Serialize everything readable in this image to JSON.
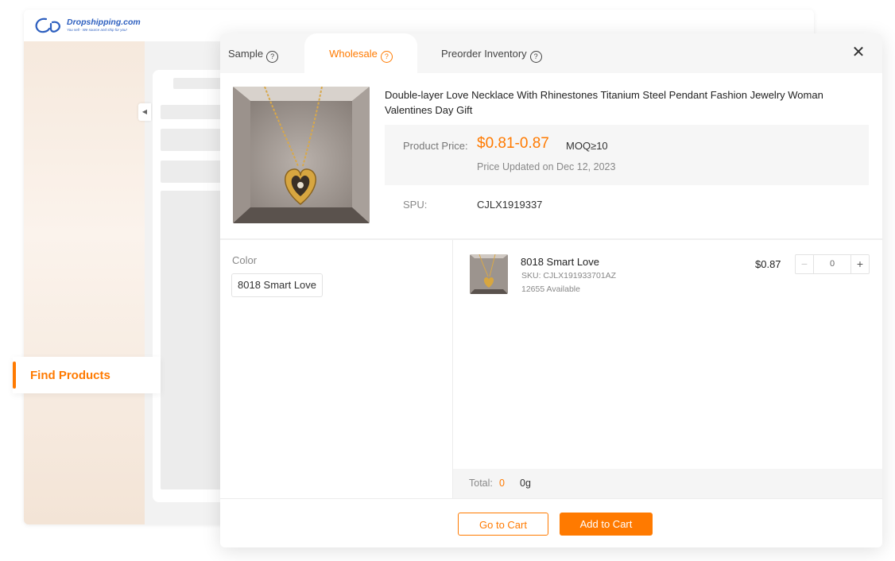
{
  "logo": {
    "text": "Dropshipping.com",
    "tagline": "You sell - We source and ship for you!"
  },
  "sidebar": {
    "find_products": "Find Products"
  },
  "modal": {
    "tabs": [
      {
        "label": "Sample",
        "help": "?"
      },
      {
        "label": "Wholesale",
        "help": "?"
      },
      {
        "label": "Preorder Inventory",
        "help": "?"
      }
    ],
    "active_tab": "Wholesale",
    "close": "✕",
    "product": {
      "title": "Double-layer Love Necklace With Rhinestones Titanium Steel Pendant Fashion Jewelry Woman Valentines Day Gift",
      "price_label": "Product Price:",
      "price": "$0.81-0.87",
      "moq": "MOQ≥10",
      "price_updated": "Price Updated on Dec 12, 2023",
      "spu_label": "SPU:",
      "spu": "CJLX1919337"
    },
    "color": {
      "label": "Color",
      "selected": "8018 Smart Love"
    },
    "variant": {
      "name": "8018 Smart Love",
      "sku": "SKU: CJLX191933701AZ",
      "stock": "12655 Available",
      "price": "$0.87",
      "quantity": "0",
      "minus": "−",
      "plus": "+"
    },
    "total": {
      "label": "Total:",
      "count": "0",
      "weight": "0g"
    },
    "buttons": {
      "go_to_cart": "Go to Cart",
      "add_to_cart": "Add to Cart"
    }
  },
  "colors": {
    "accent": "#ff7a00",
    "brand_blue": "#2d5fbf"
  },
  "icons": {
    "help": "question-circle-icon",
    "close": "close-icon",
    "collapse": "chevron-left-icon"
  }
}
